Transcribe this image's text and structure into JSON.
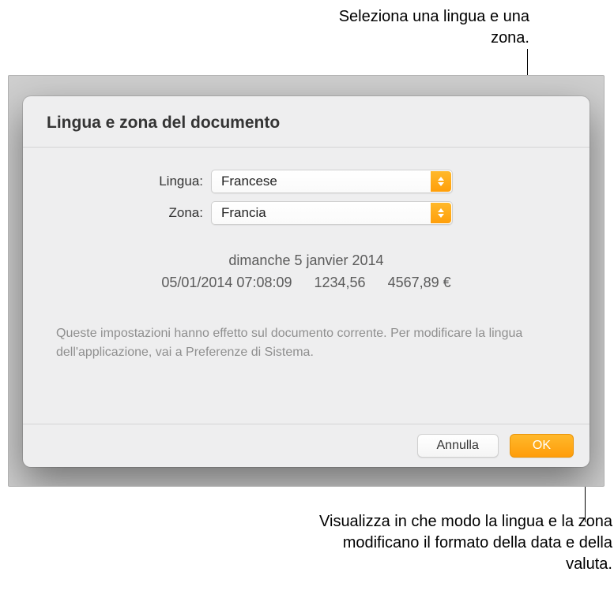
{
  "annotations": {
    "top": "Seleziona una lingua e una zona.",
    "bottom": "Visualizza in che modo la lingua e la zona modificano il formato della data e della valuta."
  },
  "dialog": {
    "title": "Lingua e zona del documento",
    "language_label": "Lingua:",
    "language_value": "Francese",
    "region_label": "Zona:",
    "region_value": "Francia",
    "preview": {
      "long_date": "dimanche 5 janvier 2014",
      "datetime": "05/01/2014 07:08:09",
      "decimal": "1234,56",
      "currency": "4567,89 €"
    },
    "help_text": "Queste impostazioni hanno effetto sul documento corrente. Per modificare la lingua dell'applicazione, vai a Preferenze di Sistema.",
    "cancel_label": "Annulla",
    "ok_label": "OK"
  }
}
